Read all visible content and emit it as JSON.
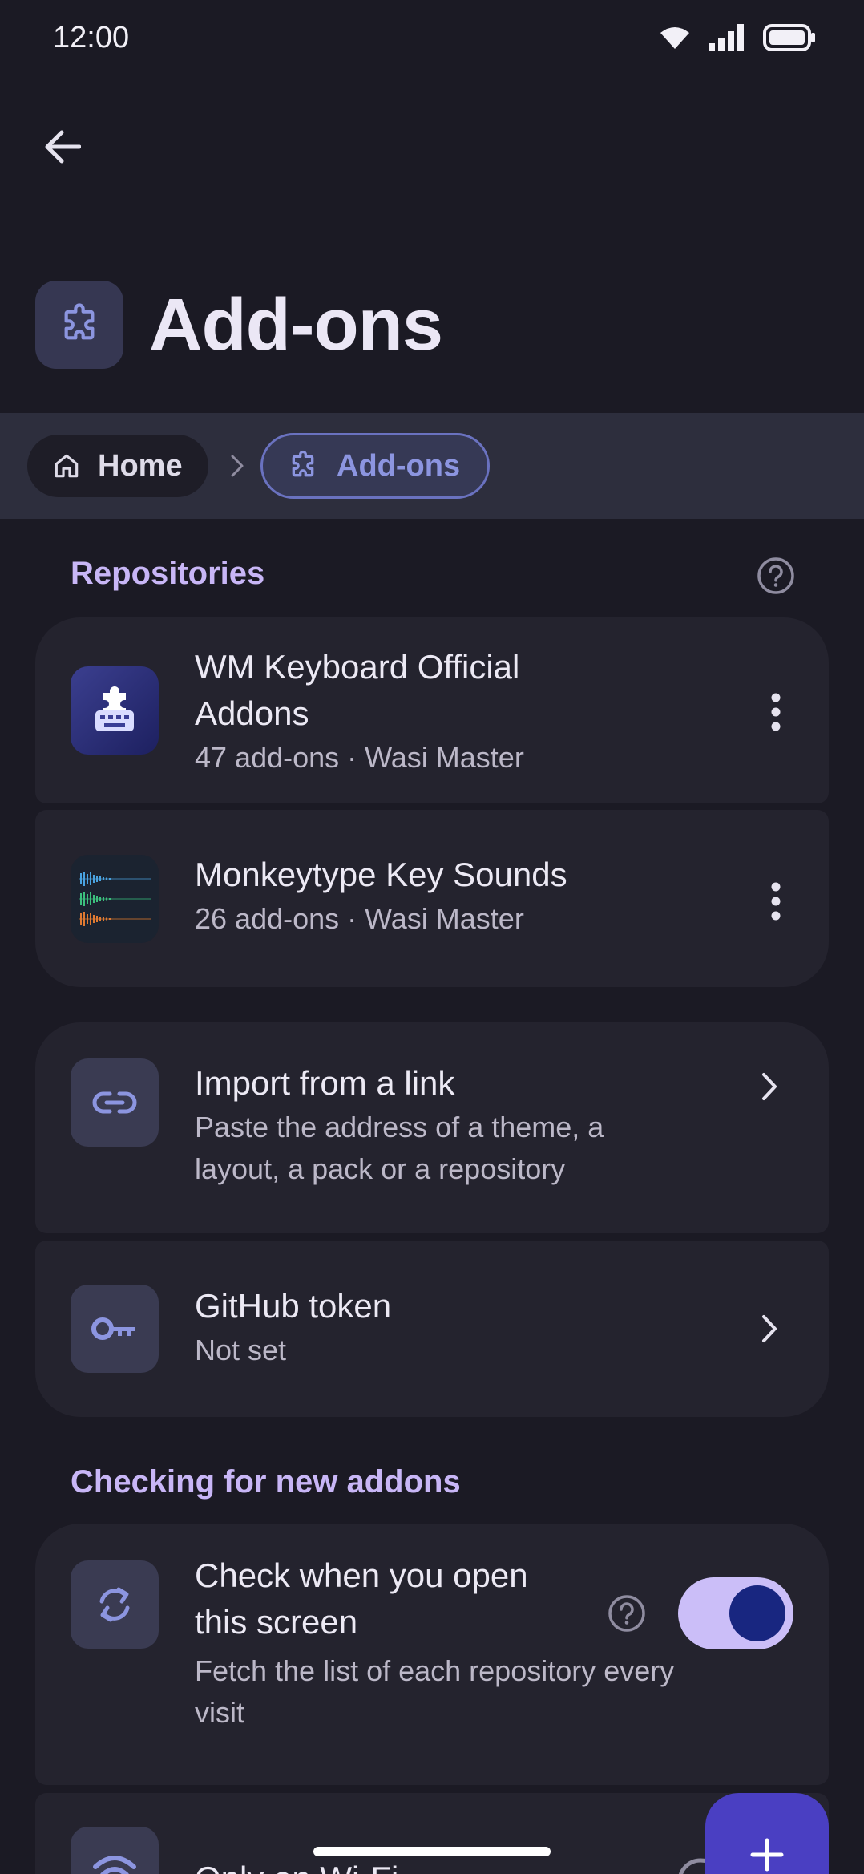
{
  "status_bar": {
    "time": "12:00",
    "icons": [
      "wifi-icon",
      "signal-icon",
      "battery-icon"
    ]
  },
  "header": {
    "title": "Add-ons",
    "icon": "puzzle-icon"
  },
  "breadcrumb": {
    "home_label": "Home",
    "current_label": "Add-ons"
  },
  "repositories": {
    "section_label": "Repositories",
    "items": [
      {
        "title_line1": "WM Keyboard Official",
        "title_line2": "Addons",
        "subtitle": "47 add-ons · Wasi Master"
      },
      {
        "title": "Monkeytype Key Sounds",
        "subtitle": "26 add-ons · Wasi Master"
      }
    ]
  },
  "import": {
    "title": "Import from a link",
    "subtitle_line1": "Paste the address of a theme, a",
    "subtitle_line2": "layout, a pack or a repository"
  },
  "github": {
    "title": "GitHub token",
    "subtitle": "Not set"
  },
  "checking": {
    "section_label": "Checking for new addons",
    "open_screen": {
      "title_line1": "Check when you open",
      "title_line2": "this screen",
      "subtitle_line1": "Fetch the list of each repository every",
      "subtitle_line2": "visit",
      "enabled": true
    },
    "wifi_only": {
      "title": "Only on Wi-Fi"
    }
  },
  "colors": {
    "background": "#1b1a24",
    "card": "#24232e",
    "accent": "#c8b6f6",
    "fab": "#4a3fc2",
    "toggle_track": "#cbbef8",
    "toggle_knob": "#182680"
  }
}
